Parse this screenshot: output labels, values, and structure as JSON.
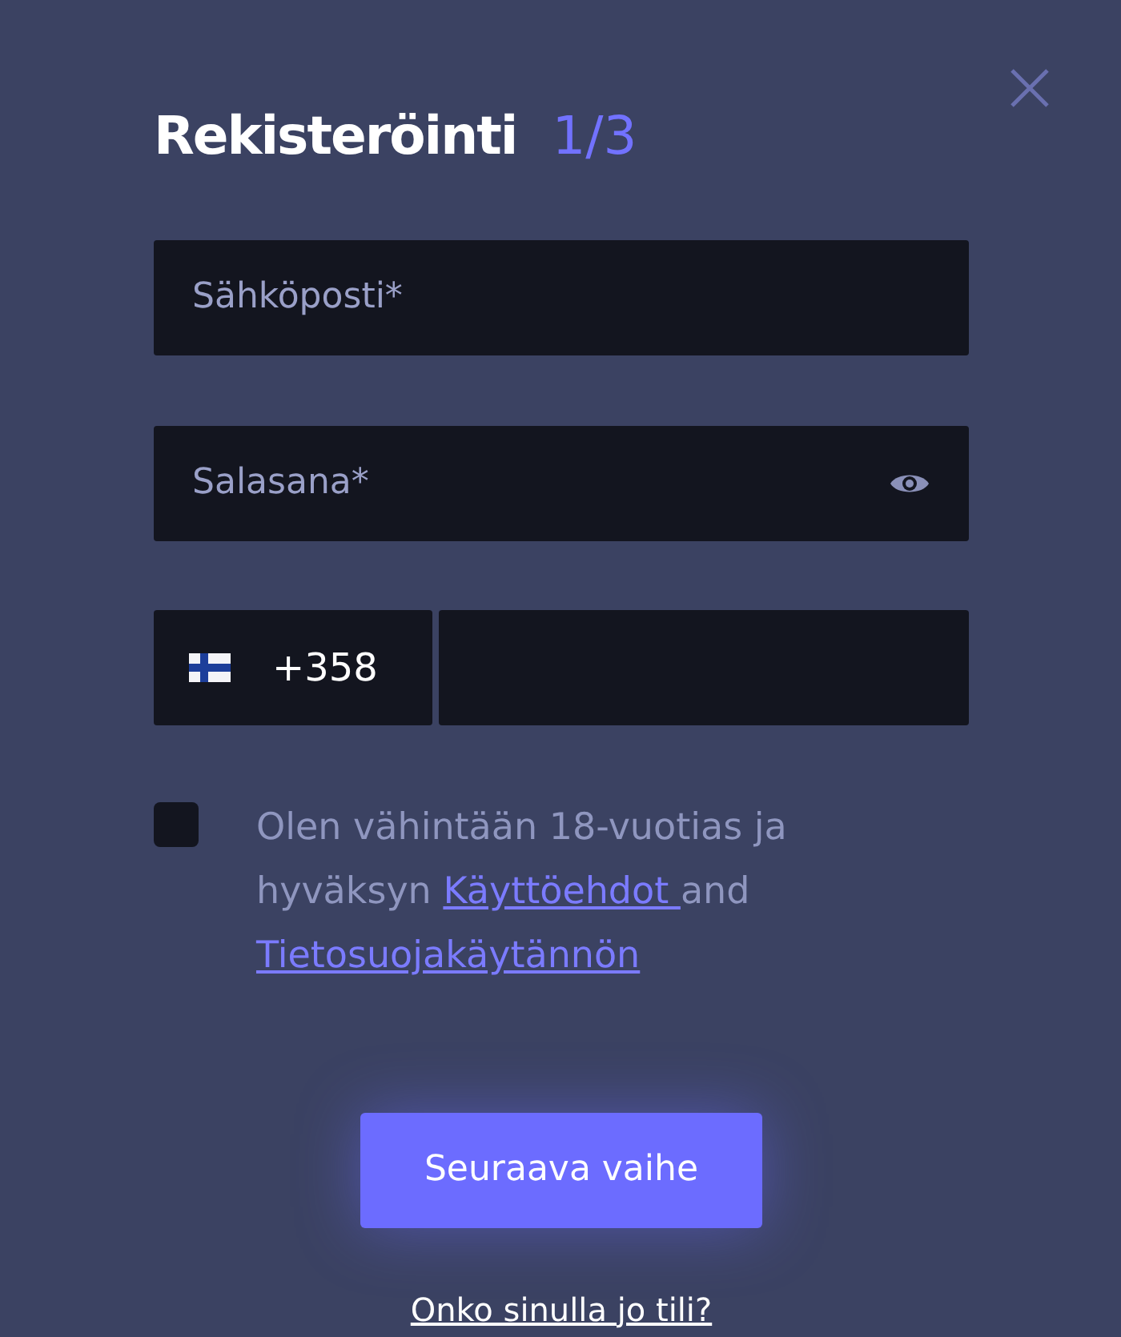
{
  "dialog": {
    "title": "Rekisteröinti",
    "step": "1/3"
  },
  "fields": [
    {
      "kind": "email",
      "placeholder": "Sähköposti*"
    },
    {
      "kind": "password",
      "placeholder": "Salasana*"
    }
  ],
  "phone": {
    "code": "+358"
  },
  "consent": {
    "checked": false,
    "parts": [
      {
        "kind": "text",
        "text": "Olen vähintään 18-vuotias ja hyväksyn "
      },
      {
        "kind": "link",
        "text": "Käyttöehdot "
      },
      {
        "kind": "text",
        "text": "and "
      },
      {
        "kind": "link",
        "text": "Tietosuojakäytännön"
      }
    ]
  },
  "next_button": "Seuraava vaihe",
  "login_link": "Onko sinulla jo tili?"
}
